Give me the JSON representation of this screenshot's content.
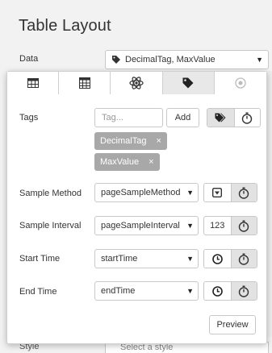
{
  "header": {
    "title": "Table Layout"
  },
  "data_field": {
    "label": "Data",
    "value": "DecimalTag, MaxValue"
  },
  "tabs": [
    {
      "icon": "table-icon",
      "active": false
    },
    {
      "icon": "calculator-icon",
      "active": false
    },
    {
      "icon": "atom-icon",
      "active": false
    },
    {
      "icon": "tag-icon",
      "active": true
    },
    {
      "icon": "circle-target-icon",
      "active": false
    }
  ],
  "tags": {
    "label": "Tags",
    "placeholder": "Tag...",
    "add_label": "Add",
    "chips": [
      {
        "text": "DecimalTag",
        "remove": "×"
      },
      {
        "text": "MaxValue",
        "remove": "×"
      }
    ]
  },
  "sample_method": {
    "label": "Sample Method",
    "value": "pageSampleMethod"
  },
  "sample_interval": {
    "label": "Sample Interval",
    "value": "pageSampleInterval",
    "toggle_text": "123"
  },
  "start_time": {
    "label": "Start Time",
    "value": "startTime"
  },
  "end_time": {
    "label": "End Time",
    "value": "endTime"
  },
  "preview_label": "Preview",
  "below_panel": {
    "label": "Style",
    "value": "Select a style"
  },
  "colors": {
    "active_tab": "#e8e8e8",
    "chip": "#a8a8a8",
    "border": "#c8c8c8"
  }
}
